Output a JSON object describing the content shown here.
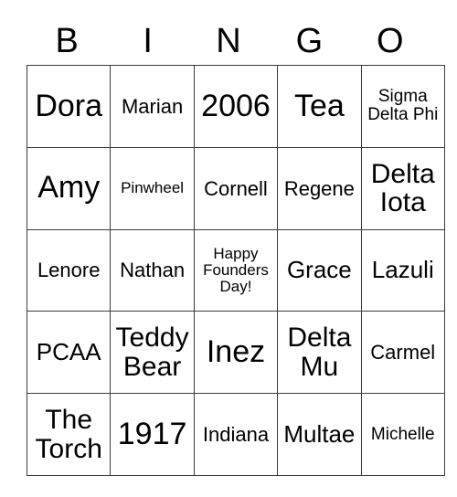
{
  "card": {
    "headers": [
      "B",
      "I",
      "N",
      "G",
      "O"
    ],
    "rows": [
      [
        {
          "text": "Dora",
          "size": "fs-xl"
        },
        {
          "text": "Marian",
          "size": "fs-sm"
        },
        {
          "text": "2006",
          "size": "fs-xl"
        },
        {
          "text": "Tea",
          "size": "fs-xl"
        },
        {
          "text": "Sigma Delta Phi",
          "size": "fs-xs"
        }
      ],
      [
        {
          "text": "Amy",
          "size": "fs-xl"
        },
        {
          "text": "Pinwheel",
          "size": "fs-xxs"
        },
        {
          "text": "Cornell",
          "size": "fs-sm"
        },
        {
          "text": "Regene",
          "size": "fs-sm"
        },
        {
          "text": "Delta Iota",
          "size": "fs-lg"
        }
      ],
      [
        {
          "text": "Lenore",
          "size": "fs-sm"
        },
        {
          "text": "Nathan",
          "size": "fs-sm"
        },
        {
          "text": "Happy Founders Day!",
          "size": "fs-xxs"
        },
        {
          "text": "Grace",
          "size": "fs-md"
        },
        {
          "text": "Lazuli",
          "size": "fs-md"
        }
      ],
      [
        {
          "text": "PCAA",
          "size": "fs-md"
        },
        {
          "text": "Teddy Bear",
          "size": "fs-lg"
        },
        {
          "text": "Inez",
          "size": "fs-xl"
        },
        {
          "text": "Delta Mu",
          "size": "fs-lg"
        },
        {
          "text": "Carmel",
          "size": "fs-sm"
        }
      ],
      [
        {
          "text": "The Torch",
          "size": "fs-lg"
        },
        {
          "text": "1917",
          "size": "fs-xl"
        },
        {
          "text": "Indiana",
          "size": "fs-sm"
        },
        {
          "text": "Multae",
          "size": "fs-md"
        },
        {
          "text": "Michelle",
          "size": "fs-xs"
        }
      ]
    ]
  },
  "colors": {
    "background": "#ffffff",
    "text": "#000000",
    "grid_line": "#3a3a3a"
  }
}
